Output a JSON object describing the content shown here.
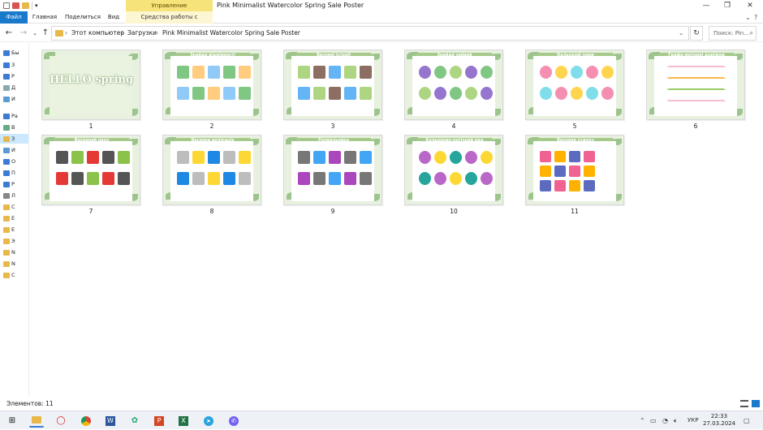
{
  "window": {
    "title": "Pink Minimalist Watercolor Spring Sale Poster",
    "context_group": "Управление",
    "colors": {
      "accent": "#1979ca",
      "context": "#f6e37a",
      "selection": "#cce8ff"
    }
  },
  "ribbon": {
    "tabs": [
      "Файл",
      "Главная",
      "Поделиться",
      "Вид"
    ],
    "context_tab": "Средства работы с рисунками"
  },
  "address": {
    "crumbs": [
      "Этот компьютер",
      "Загрузки",
      "Pink Minimalist Watercolor Spring Sale Poster"
    ],
    "search_placeholder": "Поиск: Pin..."
  },
  "sidebar": {
    "items": [
      {
        "label": "Бы",
        "icon": "star-icon"
      },
      {
        "label": "З",
        "icon": "download-icon"
      },
      {
        "label": "Р",
        "icon": "desktop-icon"
      },
      {
        "label": "Д",
        "icon": "document-icon"
      },
      {
        "label": "И",
        "icon": "picture-icon"
      },
      {
        "label": "Ра",
        "icon": "monitor-icon"
      },
      {
        "label": "В",
        "icon": "video-icon"
      },
      {
        "label": "З",
        "icon": "folder-icon"
      },
      {
        "label": "И",
        "icon": "picture-icon"
      },
      {
        "label": "О",
        "icon": "cloud-icon"
      },
      {
        "label": "П",
        "icon": "monitor-icon"
      },
      {
        "label": "Р",
        "icon": "music-icon"
      },
      {
        "label": "Л",
        "icon": "drive-icon"
      },
      {
        "label": "C",
        "icon": "folder-icon"
      },
      {
        "label": "E",
        "icon": "folder-icon"
      },
      {
        "label": "E",
        "icon": "folder-icon"
      },
      {
        "label": "Э",
        "icon": "folder-icon"
      },
      {
        "label": "N",
        "icon": "folder-icon"
      },
      {
        "label": "N",
        "icon": "folder-icon"
      },
      {
        "label": "C",
        "icon": "folder-icon"
      }
    ]
  },
  "files": [
    {
      "label": "1",
      "title": "HELLO spring",
      "theme": "cover"
    },
    {
      "label": "2",
      "title": "Знайди відмінності",
      "theme": "photos"
    },
    {
      "label": "3",
      "title": "Весняні історії",
      "theme": "stories"
    },
    {
      "label": "4",
      "title": "Знайди зайвий",
      "theme": "butterflies"
    },
    {
      "label": "5",
      "title": "Кольорові пари",
      "theme": "pairs"
    },
    {
      "label": "6",
      "title": "Графо-моторні доріжки",
      "theme": "tracks"
    },
    {
      "label": "7",
      "title": "Весняний пазл",
      "theme": "puzzle"
    },
    {
      "label": "8",
      "title": "Весняна аплікація",
      "theme": "applique"
    },
    {
      "label": "9",
      "title": "Розмальовка",
      "theme": "shapes"
    },
    {
      "label": "10",
      "title": "Кольорово-логічний ряд",
      "theme": "logic"
    },
    {
      "label": "11",
      "title": "Весняне судоку",
      "theme": "sudoku"
    }
  ],
  "status": {
    "count_text": "Элементов: 11"
  },
  "taskbar": {
    "apps": [
      "windows-start-icon",
      "file-explorer-icon",
      "opera-icon",
      "chrome-icon",
      "word-icon",
      "app-icon",
      "powerpoint-icon",
      "excel-icon",
      "telegram-icon",
      "viber-icon"
    ],
    "language": "УКР",
    "time": "22:33",
    "date": "27.03.2024"
  }
}
